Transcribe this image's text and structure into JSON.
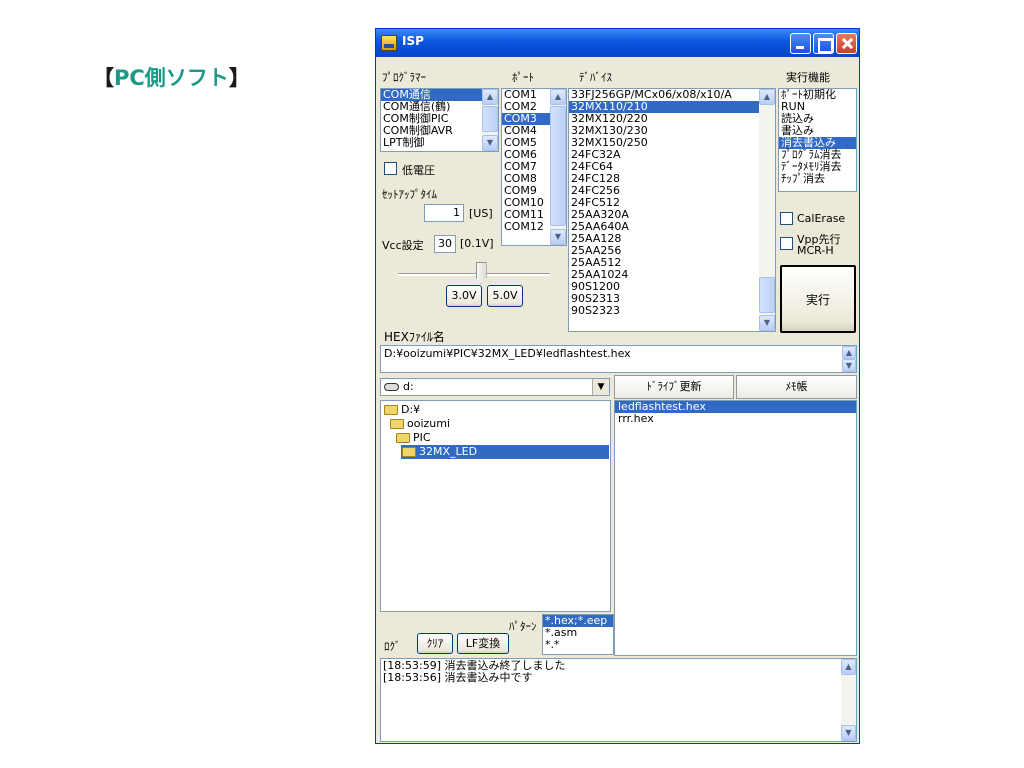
{
  "caption": {
    "open": "【",
    "text": "PC側ソフト",
    "close": "】"
  },
  "window": {
    "title": "ISP"
  },
  "programmer": {
    "label": "ﾌﾟﾛｸﾞﾗﾏｰ",
    "items": [
      "COM通信",
      "COM通信(鶴)",
      "COM制御PIC",
      "COM制御AVR",
      "LPT制御"
    ],
    "selected": "COM通信"
  },
  "port": {
    "label": "ﾎﾟｰﾄ",
    "items": [
      "COM1",
      "COM2",
      "COM3",
      "COM4",
      "COM5",
      "COM6",
      "COM7",
      "COM8",
      "COM9",
      "COM10",
      "COM11",
      "COM12"
    ],
    "selected": "COM3"
  },
  "device": {
    "label": "ﾃﾞﾊﾞｲｽ",
    "items": [
      "33FJ256GP/MCx06/x08/x10/A",
      "32MX110/210",
      "32MX120/220",
      "32MX130/230",
      "32MX150/250",
      "24FC32A",
      "24FC64",
      "24FC128",
      "24FC256",
      "24FC512",
      "25AA320A",
      "25AA640A",
      "25AA128",
      "25AA256",
      "25AA512",
      "25AA1024",
      "90S1200",
      "90S2313",
      "90S2323"
    ],
    "selected": "32MX110/210"
  },
  "functions": {
    "label": "実行機能",
    "items": [
      "ﾎﾟｰﾄ初期化",
      "RUN",
      "読込み",
      "書込み",
      "消去書込み",
      "ﾌﾟﾛｸﾞﾗﾑ消去",
      "ﾃﾞｰﾀﾒﾓﾘ消去",
      "ﾁｯﾌﾟ消去"
    ],
    "selected": "消去書込み"
  },
  "low_voltage": {
    "label": "低電圧",
    "checked": false
  },
  "setup_time": {
    "label": "ｾｯﾄｱｯﾌﾟﾀｲﾑ",
    "value": "1",
    "unit": "[US]"
  },
  "vcc": {
    "label": "Vcc設定",
    "value": "30",
    "unit": "[0.1V]",
    "slider_level": 0.55
  },
  "buttons": {
    "v30": "3.0V",
    "v50": "5.0V",
    "run": "実行"
  },
  "options": {
    "calerase": {
      "label": "CalErase",
      "checked": false
    },
    "vpp": {
      "label": "Vpp先行",
      "label2": "MCR-H",
      "checked": false
    }
  },
  "hex": {
    "label": "HEXﾌｧｲﾙ名",
    "path": "D:¥ooizumi¥PIC¥32MX_LED¥ledflashtest.hex"
  },
  "drive": {
    "value": "d:"
  },
  "tabs": {
    "drive_refresh": "ﾄﾞﾗｲﾌﾞ更新",
    "notepad": "ﾒﾓ帳"
  },
  "folders": [
    "D:¥",
    "ooizumi",
    "PIC",
    "32MX_LED"
  ],
  "files": [
    "ledflashtest.hex",
    "rrr.hex"
  ],
  "pattern": {
    "label": "ﾊﾟﾀｰﾝ",
    "items": [
      "*.hex;*.eep",
      "*.asm",
      "*.*"
    ],
    "selected": "*.hex;*.eep"
  },
  "log": {
    "label": "ﾛｸﾞ",
    "clear": "ｸﾘｱ",
    "lf": "LF変換",
    "lines": [
      "[18:53:59] 消去書込み終了しました",
      "[18:53:56] 消去書込み中です"
    ]
  }
}
